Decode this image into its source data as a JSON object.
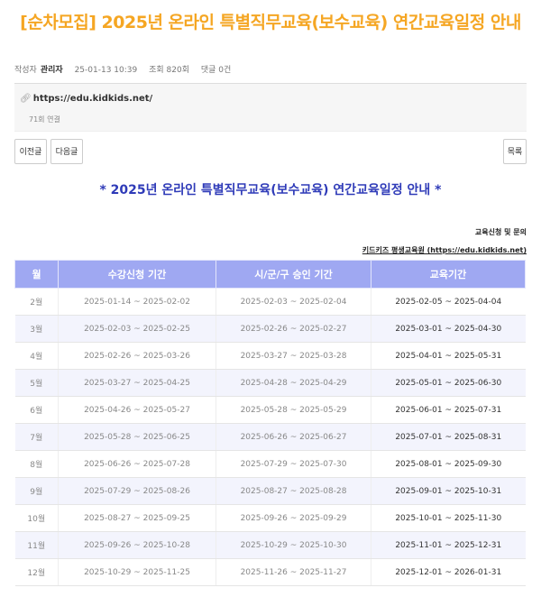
{
  "post": {
    "title": "[순차모집] 2025년 온라인 특별직무교육(보수교육) 연간교육일정 안내",
    "author_label": "작성자",
    "author": "관리자",
    "datetime": "25-01-13 10:39",
    "views": "조회 820회",
    "comments": "댓글 0건"
  },
  "link": {
    "url": "https://edu.kidkids.net/",
    "count": "71회 연결"
  },
  "nav": {
    "prev": "이전글",
    "next": "다음글",
    "list": "목록"
  },
  "content": {
    "headline": "* 2025년 온라인 특별직무교육(보수교육) 연간교육일정 안내 *",
    "contact_label": "교육신청 및 문의",
    "contact_link": "키드키즈 평생교육원 (https://edu.kidkids.net)"
  },
  "table": {
    "headers": [
      "월",
      "수강신청 기간",
      "시/군/구 승인 기간",
      "교육기간"
    ],
    "rows": [
      [
        "2월",
        "2025-01-14 ~ 2025-02-02",
        "2025-02-03 ~ 2025-02-04",
        "2025-02-05 ~ 2025-04-04"
      ],
      [
        "3월",
        "2025-02-03 ~ 2025-02-25",
        "2025-02-26 ~ 2025-02-27",
        "2025-03-01 ~ 2025-04-30"
      ],
      [
        "4월",
        "2025-02-26 ~ 2025-03-26",
        "2025-03-27 ~ 2025-03-28",
        "2025-04-01 ~ 2025-05-31"
      ],
      [
        "5월",
        "2025-03-27 ~ 2025-04-25",
        "2025-04-28 ~ 2025-04-29",
        "2025-05-01 ~ 2025-06-30"
      ],
      [
        "6월",
        "2025-04-26 ~ 2025-05-27",
        "2025-05-28 ~ 2025-05-29",
        "2025-06-01 ~ 2025-07-31"
      ],
      [
        "7월",
        "2025-05-28 ~ 2025-06-25",
        "2025-06-26 ~ 2025-06-27",
        "2025-07-01 ~ 2025-08-31"
      ],
      [
        "8월",
        "2025-06-26 ~ 2025-07-28",
        "2025-07-29 ~ 2025-07-30",
        "2025-08-01 ~ 2025-09-30"
      ],
      [
        "9월",
        "2025-07-29 ~ 2025-08-26",
        "2025-08-27 ~ 2025-08-28",
        "2025-09-01 ~ 2025-10-31"
      ],
      [
        "10월",
        "2025-08-27 ~ 2025-09-25",
        "2025-09-26 ~ 2025-09-29",
        "2025-10-01 ~ 2025-11-30"
      ],
      [
        "11월",
        "2025-09-26 ~ 2025-10-28",
        "2025-10-29 ~ 2025-10-30",
        "2025-11-01 ~ 2025-12-31"
      ],
      [
        "12월",
        "2025-10-29 ~ 2025-11-25",
        "2025-11-26 ~ 2025-11-27",
        "2025-12-01 ~ 2026-01-31"
      ]
    ]
  },
  "colors": {
    "title": "#f5a623",
    "headline": "#2f3bb8",
    "table_header": "#9fa8f2",
    "row_alt": "#f3f4fd"
  },
  "icons": {
    "link": "paperclip-icon"
  }
}
